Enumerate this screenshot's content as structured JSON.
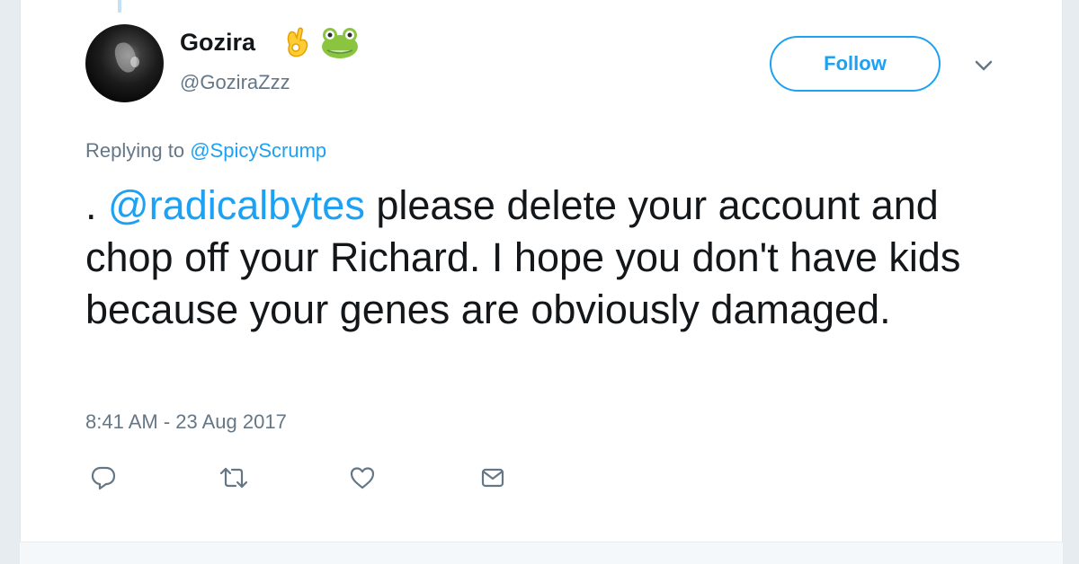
{
  "user": {
    "display_name": "Gozira",
    "handle": "@GoziraZzz",
    "emojis": [
      "ok-hand-emoji",
      "frog-emoji"
    ]
  },
  "follow_button": {
    "label": "Follow"
  },
  "reply_context": {
    "prefix": "Replying to",
    "mention": "@SpicyScrump"
  },
  "tweet": {
    "lead": ". ",
    "mention": "@radicalbytes",
    "body": " please delete your account and chop off your Richard. I hope you don't have kids because your genes are obviously damaged."
  },
  "timestamp": "8:41 AM - 23 Aug 2017",
  "actions": [
    "reply-icon",
    "retweet-icon",
    "like-icon",
    "direct-message-icon"
  ],
  "colors": {
    "accent": "#1da1f2",
    "text": "#14171a",
    "secondary": "#657786",
    "icon": "#657786"
  }
}
